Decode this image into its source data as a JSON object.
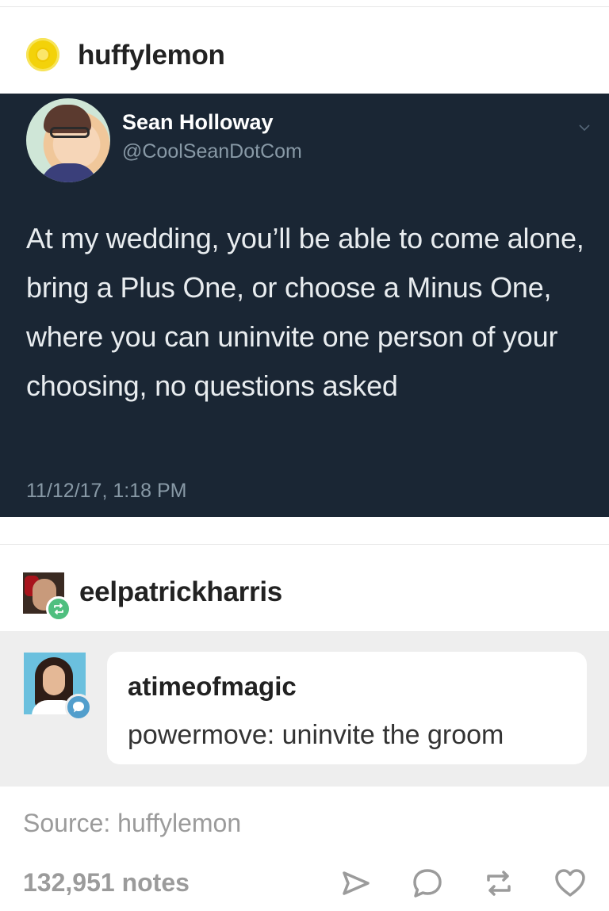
{
  "post": {
    "author": "huffylemon",
    "avatar_icon": "lemon-avatar-icon"
  },
  "tweet": {
    "name": "Sean Holloway",
    "handle": "@CoolSeanDotCom",
    "text": "At my wedding, you’ll be able to come alone, bring a Plus One, or choose a Minus One, where you can uninvite one person of your choosing, no questions asked",
    "timestamp": "11/12/17, 1:18 PM",
    "background": "#1a2634"
  },
  "reblog": {
    "username": "eelpatrickharris",
    "badge_color": "#4fbf7f"
  },
  "comment": {
    "username": "atimeofmagic",
    "text": "powermove: uninvite the groom",
    "badge_color": "#529ecc"
  },
  "footer": {
    "source": "Source: huffylemon",
    "notes": "132,951 notes",
    "actions": [
      "share-icon",
      "reply-icon",
      "reblog-icon",
      "like-icon"
    ]
  }
}
